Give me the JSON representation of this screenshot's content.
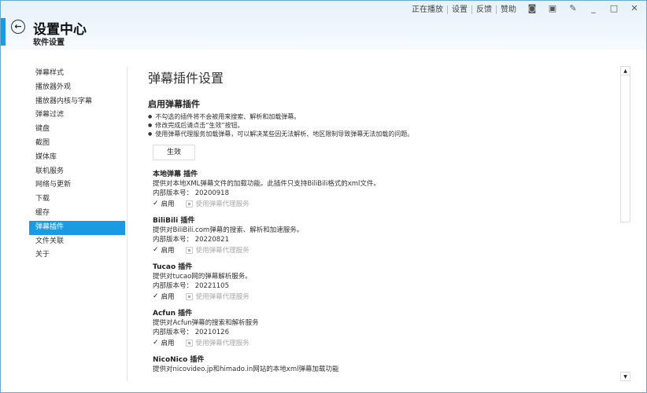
{
  "topnav": [
    "正在播放",
    "设置",
    "反馈",
    "赞助"
  ],
  "window_controls": [
    "camera",
    "minimode",
    "pin",
    "minimize",
    "maximize",
    "close"
  ],
  "header": {
    "title": "设置中心",
    "subtitle": "软件设置"
  },
  "sidebar": {
    "items": [
      "弹幕样式",
      "播放器外观",
      "播放器内核与字幕",
      "弹幕过滤",
      "键盘",
      "截图",
      "媒体库",
      "联机服务",
      "网络与更新",
      "下载",
      "缓存",
      "弹幕插件",
      "文件关联",
      "关于"
    ],
    "active": "弹幕插件"
  },
  "main": {
    "title": "弹幕插件设置",
    "section_title": "启用弹幕插件",
    "bullets": [
      "不勾选的插件将不会被用来搜索、解析和加载弹幕。",
      "修改完成后请点击“生效”按钮。",
      "使用弹幕代理服务加载弹幕，可以解决某些因无法解析、地区限制导致弹幕无法加载的问题。"
    ],
    "apply_label": "生效",
    "version_label": "内部版本号：",
    "enable_label": "启用",
    "proxy_label": "使用弹幕代理服务",
    "plugins": [
      {
        "name": "本地弹幕 插件",
        "desc": "提供对本地XML弹幕文件的加载功能。此插件只支持BiliBili格式的xml文件。",
        "version": "20200918",
        "enabled": true,
        "proxy": false
      },
      {
        "name": "BiliBili 插件",
        "desc": "提供对BiliBili.com弹幕的搜索、解析和加速服务。",
        "version": "20220821",
        "enabled": true,
        "proxy": false
      },
      {
        "name": "Tucao 插件",
        "desc": "提供对tucao网的弹幕解析服务。",
        "version": "20221105",
        "enabled": true,
        "proxy": false
      },
      {
        "name": "Acfun 插件",
        "desc": "提供对Acfun弹幕的搜索和解析服务",
        "version": "20210126",
        "enabled": true,
        "proxy": false
      },
      {
        "name": "NicoNico 插件",
        "desc": "提供对nicovideo.jp和himado.in网站的本地xml弹幕加载功能"
      }
    ]
  }
}
